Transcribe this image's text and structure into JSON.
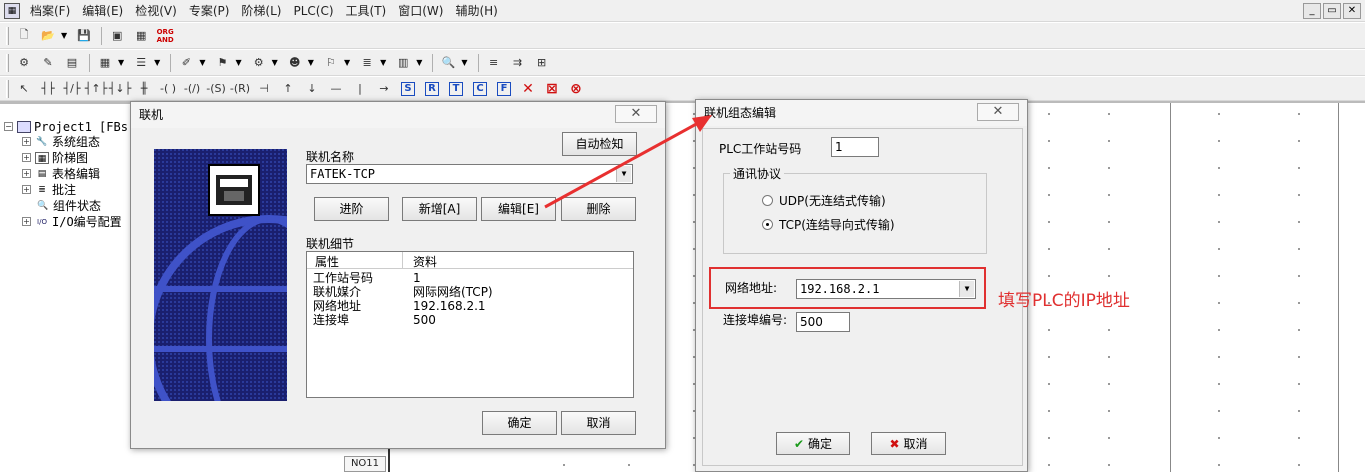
{
  "menu": [
    "档案(F)",
    "编辑(E)",
    "检视(V)",
    "专案(P)",
    "阶梯(L)",
    "PLC(C)",
    "工具(T)",
    "窗口(W)",
    "辅助(H)"
  ],
  "window_controls": [
    "_",
    "▭",
    "✕"
  ],
  "toolbar_texts": {
    "org_and_1": "ORG",
    "org_and_2": "AND"
  },
  "toolbar3": {
    "contacts": [
      "┤├",
      "┤/├",
      "┤↑├",
      "┤↓├"
    ],
    "boxed": [
      "S",
      "R",
      "T",
      "C",
      "F"
    ]
  },
  "tree": {
    "root": "Project1 [FBs",
    "items": [
      "系统组态",
      "阶梯图",
      "表格编辑",
      "批注",
      "组件状态",
      "I/O编号配置"
    ]
  },
  "ladder": {
    "coil_label": "NO11"
  },
  "link_dialog": {
    "title": "联机",
    "close": "✕",
    "auto_detect": "自动检知",
    "name_label": "联机名称",
    "name_value": "FATEK-TCP",
    "buttons": {
      "advanced": "进阶",
      "add": "新增[A]",
      "edit": "编辑[E]",
      "delete": "删除"
    },
    "details_label": "联机细节",
    "table": {
      "headers": [
        "属性",
        "资料"
      ],
      "rows": [
        [
          "工作站号码",
          "1"
        ],
        [
          "联机媒介",
          "网际网络(TCP)"
        ],
        [
          "网络地址",
          "192.168.2.1"
        ],
        [
          "连接埠",
          "500"
        ]
      ]
    },
    "ok": "确定",
    "cancel": "取消"
  },
  "config_dialog": {
    "title": "联机组态编辑",
    "close": "✕",
    "station_label": "PLC工作站号码",
    "station_value": "1",
    "protocol_group": "通讯协议",
    "udp_label": "UDP(无连结式传输)",
    "tcp_label": "TCP(连结导向式传输)",
    "ip_label": "网络地址:",
    "ip_value": "192.168.2.1",
    "port_label": "连接埠编号:",
    "port_value": "500",
    "ok": "确定",
    "cancel": "取消"
  },
  "annotation": "填写PLC的IP地址",
  "colors": {
    "annotation_red": "#e03030",
    "dialog_bg": "#f0f0f0",
    "banner_blue": "#1a1f6e"
  }
}
